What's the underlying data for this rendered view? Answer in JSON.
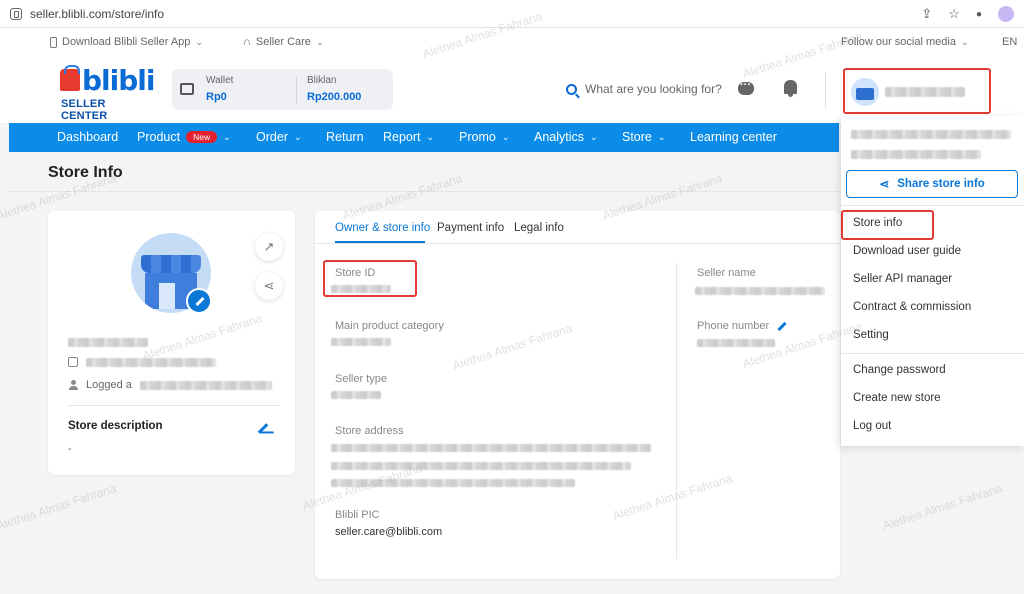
{
  "browser": {
    "url": "seller.blibli.com/store/info"
  },
  "utility_bar": {
    "download_app": "Download Blibli Seller App",
    "seller_care": "Seller Care",
    "follow_social": "Follow our social media",
    "language": "EN"
  },
  "header": {
    "logo_word": "blibli",
    "logo_sub": "SELLER CENTER",
    "wallet_label": "Wallet",
    "wallet_value": "Rp0",
    "bliklan_label": "Bliklan",
    "bliklan_value": "Rp200.000",
    "search_placeholder": "What are you looking for?"
  },
  "nav": {
    "items": [
      {
        "label": "Dashboard"
      },
      {
        "label": "Product",
        "badge": "New"
      },
      {
        "label": "Order"
      },
      {
        "label": "Return"
      },
      {
        "label": "Report"
      },
      {
        "label": "Promo"
      },
      {
        "label": "Analytics"
      },
      {
        "label": "Store"
      },
      {
        "label": "Learning center"
      }
    ]
  },
  "page": {
    "title": "Store Info"
  },
  "store_card": {
    "logged_as_label": "Logged a",
    "description_label": "Store description",
    "description_value": "-"
  },
  "tabs": [
    {
      "label": "Owner & store info",
      "active": true
    },
    {
      "label": "Payment info"
    },
    {
      "label": "Legal info"
    }
  ],
  "fields": {
    "store_id_label": "Store ID",
    "main_category_label": "Main product category",
    "seller_type_label": "Seller type",
    "store_address_label": "Store address",
    "blibli_pic_label": "Blibli PIC",
    "blibli_pic_value": "seller.care@blibli.com",
    "seller_name_label": "Seller name",
    "phone_label": "Phone number"
  },
  "dropdown": {
    "share_label": "Share store info",
    "menu": [
      "Store info",
      "Download user guide",
      "Seller API manager",
      "Contract & commission",
      "Setting",
      "Change password",
      "Create new store",
      "Log out"
    ]
  },
  "watermark": "Alethea Almas Fahrana",
  "colors": {
    "nav_blue": "#0c8ce9",
    "accent_blue": "#0a77d6",
    "highlight_red": "#e53935",
    "new_badge_red": "#e4202f"
  }
}
